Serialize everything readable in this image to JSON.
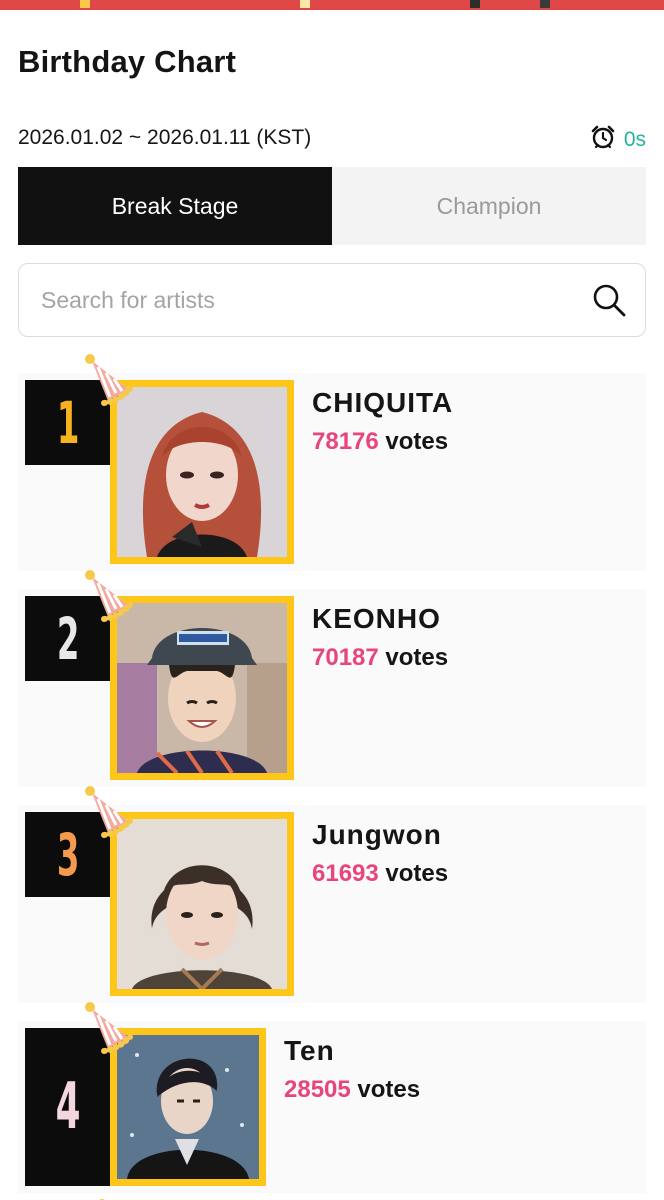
{
  "header": {
    "title": "Birthday Chart",
    "date_range": "2026.01.02 ~ 2026.01.11 (KST)",
    "timer_value": "0s"
  },
  "tabs": [
    {
      "label": "Break Stage",
      "active": true
    },
    {
      "label": "Champion",
      "active": false
    }
  ],
  "search": {
    "placeholder": "Search for artists",
    "value": ""
  },
  "ranking": [
    {
      "rank": "1",
      "name": "CHIQUITA",
      "votes": "78176",
      "votes_suffix": "votes",
      "rank_color": "#f7b21f"
    },
    {
      "rank": "2",
      "name": "KEONHO",
      "votes": "70187",
      "votes_suffix": "votes",
      "rank_color": "#e8e8e8"
    },
    {
      "rank": "3",
      "name": "Jungwon",
      "votes": "61693",
      "votes_suffix": "votes",
      "rank_color": "#f39a4c"
    },
    {
      "rank": "4",
      "name": "Ten",
      "votes": "28505",
      "votes_suffix": "votes",
      "rank_color": "#f4d7de"
    }
  ],
  "colors": {
    "accent_pink": "#e8457a",
    "timer_green": "#22b59b",
    "frame_yellow": "#ffc61a",
    "tab_active_bg": "#111111"
  },
  "icons": {
    "timer": "alarm-clock-icon",
    "search": "search-icon",
    "decoration": "party-hat-icon"
  }
}
